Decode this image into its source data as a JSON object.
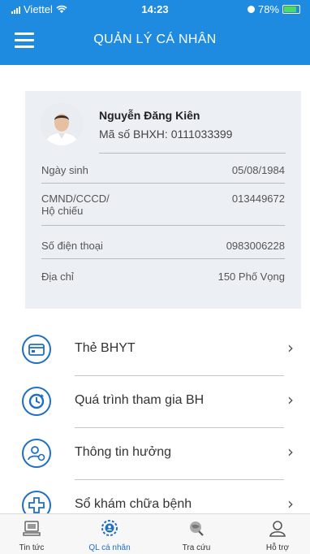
{
  "status_bar": {
    "carrier": "Viettel",
    "time": "14:23",
    "battery": "78%"
  },
  "header": {
    "title": "QUẢN LÝ CÁ NHÂN"
  },
  "profile": {
    "name": "Nguyễn Đăng Kiên",
    "code": "Mã số BHXH: 0111033399",
    "rows": [
      {
        "label": "Ngày sinh",
        "value": "05/08/1984"
      },
      {
        "label": "CMND/CCCD/",
        "label2": "Hộ chiếu",
        "value": "013449672"
      },
      {
        "label": "Số điện thoại",
        "value": "0983006228"
      },
      {
        "label": "Địa chỉ",
        "value": "150 Phố Vọng"
      }
    ]
  },
  "menu": [
    {
      "label": "Thẻ BHYT",
      "icon": "health-card-icon"
    },
    {
      "label": "Quá trình tham gia BH",
      "icon": "history-icon"
    },
    {
      "label": "Thông tin hưởng",
      "icon": "benefit-user-icon"
    },
    {
      "label": "Sổ khám chữa bệnh",
      "icon": "medical-cross-icon"
    }
  ],
  "tabs": [
    {
      "label": "Tin tức",
      "icon": "news-icon"
    },
    {
      "label": "QL cá nhân",
      "icon": "personal-settings-icon"
    },
    {
      "label": "Tra cứu",
      "icon": "lookup-globe-icon"
    },
    {
      "label": "Hỗ trợ",
      "icon": "support-user-icon"
    }
  ],
  "colors": {
    "primary": "#1e8be0",
    "accent": "#1e6fc4",
    "card_bg": "#eceff3"
  }
}
